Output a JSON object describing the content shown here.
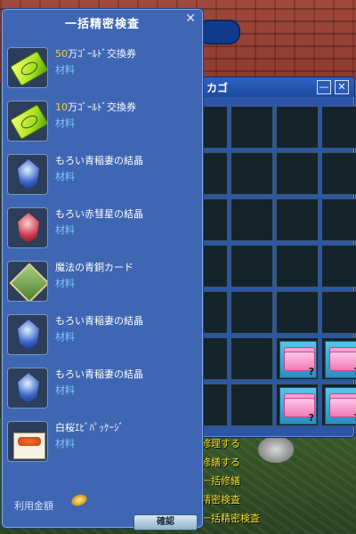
{
  "panel": {
    "title": "一括精密検査",
    "close_glyph": "✕",
    "items": [
      {
        "qty": "50",
        "name": "万ｺﾞｰﾙﾄﾞ交換券",
        "category": "材料",
        "icon": "gold-ticket-icon"
      },
      {
        "qty": "10",
        "name": "万ｺﾞｰﾙﾄﾞ交換券",
        "category": "材料",
        "icon": "gold-ticket-icon"
      },
      {
        "qty": "",
        "name": "もろい青稲妻の結晶",
        "category": "材料",
        "icon": "blue-crystal-icon"
      },
      {
        "qty": "",
        "name": "もろい赤彗星の結晶",
        "category": "材料",
        "icon": "red-crystal-icon"
      },
      {
        "qty": "",
        "name": "魔法の青銅カード",
        "category": "材料",
        "icon": "bronze-card-icon"
      },
      {
        "qty": "",
        "name": "もろい青稲妻の結晶",
        "category": "材料",
        "icon": "blue-crystal-icon"
      },
      {
        "qty": "",
        "name": "もろい青稲妻の結晶",
        "category": "材料",
        "icon": "blue-crystal-icon"
      },
      {
        "qty": "",
        "name": "白桜ｴﾋﾞﾊﾟｯｹｰｼﾞ",
        "category": "材料",
        "icon": "shrimp-package-icon"
      }
    ],
    "cost_label": "利用金額",
    "confirm_label": "確認"
  },
  "basket": {
    "title": "カゴ",
    "minimize_glyph": "—",
    "close_glyph": "✕",
    "item_mark": "?"
  },
  "context_menu": {
    "items": [
      "修理する",
      "修繕する",
      "一括修繕",
      "精密検査",
      "一括精密検査"
    ]
  }
}
